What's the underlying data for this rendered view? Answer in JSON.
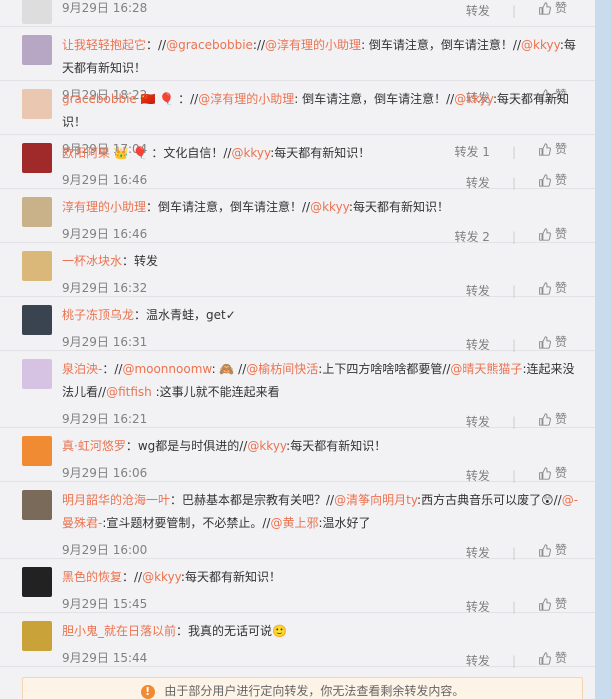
{
  "reposts": [
    {
      "segments": [],
      "time": "9月29日 16:28",
      "forward": "转发",
      "like": "赞",
      "avatar_bg": "#ddd"
    },
    {
      "segments": [
        {
          "t": "让我轻轻抱起它",
          "c": "user"
        },
        {
          "t": "：//"
        },
        {
          "t": "@gracebobbie",
          "c": "at"
        },
        {
          "t": ":"
        },
        {
          "t": "//"
        },
        {
          "t": "@淳有理的小助理",
          "c": "at"
        },
        {
          "t": ": 倒车请注意，倒车请注意！//"
        },
        {
          "t": "@kkyy",
          "c": "at"
        },
        {
          "t": ":每天都有新知识！"
        }
      ],
      "time": "9月29日 18:22",
      "forward": "转发",
      "like": "赞",
      "avatar_bg": "#b7a6c4"
    },
    {
      "segments": [
        {
          "t": "gracebobbie",
          "c": "user"
        },
        {
          "t": " 🇨🇳 🎈 ：//"
        },
        {
          "t": "@淳有理的小助理",
          "c": "at"
        },
        {
          "t": ": 倒车请注意，倒车请注意！//"
        },
        {
          "t": "@kkyy",
          "c": "at"
        },
        {
          "t": ":每天都有新知识！"
        }
      ],
      "time": "9月29日 17:04",
      "forward": "转发 1",
      "like": "赞",
      "avatar_bg": "#e9c7b0"
    },
    {
      "segments": [
        {
          "t": "欧阳阿果",
          "c": "user"
        },
        {
          "t": " 👑 🎈 ：文化自信！//"
        },
        {
          "t": "@kkyy",
          "c": "at"
        },
        {
          "t": ":每天都有新知识！"
        }
      ],
      "time": "9月29日 16:46",
      "forward": "转发",
      "like": "赞",
      "avatar_bg": "#a02a2a"
    },
    {
      "segments": [
        {
          "t": "淳有理的小助理",
          "c": "user"
        },
        {
          "t": "：倒车请注意，倒车请注意！//"
        },
        {
          "t": "@kkyy",
          "c": "at"
        },
        {
          "t": ":每天都有新知识！"
        }
      ],
      "time": "9月29日 16:46",
      "forward": "转发 2",
      "like": "赞",
      "avatar_bg": "#c9b18a"
    },
    {
      "segments": [
        {
          "t": "一杯冰块水",
          "c": "user"
        },
        {
          "t": "：转发"
        }
      ],
      "time": "9月29日 16:32",
      "forward": "转发",
      "like": "赞",
      "avatar_bg": "#d9b87a"
    },
    {
      "segments": [
        {
          "t": "桃子冻顶乌龙",
          "c": "user"
        },
        {
          "t": "：温水青蛙，get✓"
        }
      ],
      "time": "9月29日 16:31",
      "forward": "转发",
      "like": "赞",
      "avatar_bg": "#3a4450"
    },
    {
      "segments": [
        {
          "t": "泉泊泱-",
          "c": "user"
        },
        {
          "t": "：//"
        },
        {
          "t": "@moonnoomw",
          "c": "at"
        },
        {
          "t": ": 🙈 //"
        },
        {
          "t": "@榆枋间快活",
          "c": "at"
        },
        {
          "t": ":上下四方啥啥啥都要管//"
        },
        {
          "t": "@晴天熊猫子",
          "c": "at"
        },
        {
          "t": ":连起来没法儿看//"
        },
        {
          "t": "@fitfish",
          "c": "at"
        },
        {
          "t": " :这事儿就不能连起来看"
        }
      ],
      "time": "9月29日 16:21",
      "forward": "转发",
      "like": "赞",
      "avatar_bg": "#d6c3e3"
    },
    {
      "segments": [
        {
          "t": "真·虹河悠罗",
          "c": "user"
        },
        {
          "t": "：wg都是与时俱进的//"
        },
        {
          "t": "@kkyy",
          "c": "at"
        },
        {
          "t": ":每天都有新知识！"
        }
      ],
      "time": "9月29日 16:06",
      "forward": "转发",
      "like": "赞",
      "avatar_bg": "#f08a33"
    },
    {
      "segments": [
        {
          "t": "明月韶华的沧海一叶",
          "c": "user"
        },
        {
          "t": "：巴赫基本都是宗教有关吧？//"
        },
        {
          "t": "@清筝向明月ty",
          "c": "at"
        },
        {
          "t": ":西方古典音乐可以废了😲//"
        },
        {
          "t": "@-曼殊君-",
          "c": "at"
        },
        {
          "t": ":宣斗题材要管制，不必禁止。//"
        },
        {
          "t": "@黄上邪",
          "c": "at"
        },
        {
          "t": ":温水好了"
        }
      ],
      "time": "9月29日 16:00",
      "forward": "转发",
      "like": "赞",
      "avatar_bg": "#7a6a5a"
    },
    {
      "segments": [
        {
          "t": "黑色的恢复",
          "c": "user"
        },
        {
          "t": "：//"
        },
        {
          "t": "@kkyy",
          "c": "at"
        },
        {
          "t": ":每天都有新知识！"
        }
      ],
      "time": "9月29日 15:45",
      "forward": "转发",
      "like": "赞",
      "avatar_bg": "#222"
    },
    {
      "segments": [
        {
          "t": "胆小鬼_就在日落以前",
          "c": "user"
        },
        {
          "t": "：我真的无话可说🙂"
        }
      ],
      "time": "9月29日 15:44",
      "forward": "转发",
      "like": "赞",
      "avatar_bg": "#c9a23a"
    }
  ],
  "notice": {
    "icon": "!",
    "text": "由于部分用户进行定向转发，你无法查看剩余转发内容。"
  },
  "colors": {
    "link": "#eb7350",
    "meta": "#808080",
    "notice_icon": "#f08a33"
  }
}
